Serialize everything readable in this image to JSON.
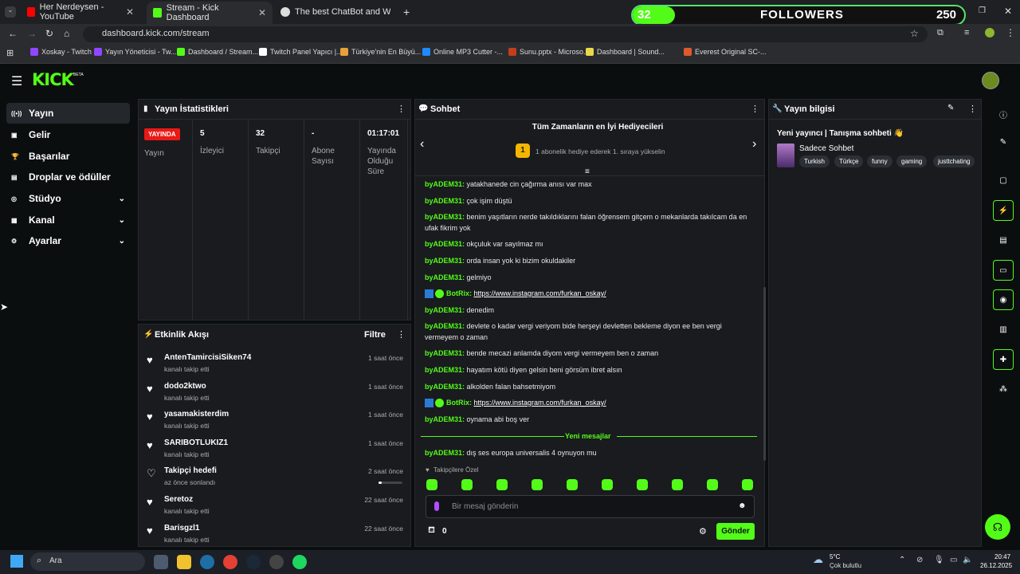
{
  "browser": {
    "tabs": [
      {
        "title": "Her Nerdeysen - YouTube"
      },
      {
        "title": "Stream - Kick Dashboard"
      },
      {
        "title": "The best ChatBot and Widgets"
      }
    ],
    "url": "dashboard.kick.com/stream",
    "bookmarks": [
      "Xoskay - Twitch",
      "Yayın Yöneticisi - Tw...",
      "Dashboard / Stream...",
      "Twitch Panel Yapıcı |...",
      "Türkiye'nin En Büyü...",
      "Online MP3 Cutter -...",
      "Sunu.pptx - Microso...",
      "Dashboard | Sound...",
      "Everest Original SC-..."
    ]
  },
  "overlay": {
    "current": "32",
    "label": "FOLLOWERS",
    "goal": "250",
    "progress": 0.128
  },
  "kick": {
    "logo": "KICK",
    "beta": "BETA"
  },
  "nav": [
    {
      "label": "Yayın",
      "icon": "broadcast-icon"
    },
    {
      "label": "Gelir",
      "icon": "money-icon"
    },
    {
      "label": "Başarılar",
      "icon": "trophy-icon"
    },
    {
      "label": "Droplar ve ödüller",
      "icon": "gift-icon"
    },
    {
      "label": "Stüdyo",
      "icon": "camera-icon"
    },
    {
      "label": "Kanal",
      "icon": "channel-icon"
    },
    {
      "label": "Ayarlar",
      "icon": "gear-icon"
    }
  ],
  "stats": {
    "title": "Yayın İstatistikleri",
    "live_badge": "YAYINDA",
    "live_label": "Yayın",
    "items": [
      {
        "value": "5",
        "label": "İzleyici"
      },
      {
        "value": "32",
        "label": "Takipçi"
      },
      {
        "value": "-",
        "label": "Abone Sayısı"
      },
      {
        "value": "01:17:01",
        "label": "Yayında Olduğu Süre"
      }
    ]
  },
  "events": {
    "title": "Etkinlik Akışı",
    "filter": "Filtre",
    "items": [
      {
        "name": "AntenTamircisiSiken74",
        "sub": "kanalı takip etti",
        "time": "1 saat önce"
      },
      {
        "name": "dodo2ktwo",
        "sub": "kanalı takip etti",
        "time": "1 saat önce"
      },
      {
        "name": "yasamakisterdim",
        "sub": "kanalı takip etti",
        "time": "1 saat önce"
      },
      {
        "name": "SARIBOTLUKIZ1",
        "sub": "kanalı takip etti",
        "time": "1 saat önce"
      },
      {
        "name": "Takipçi hedefi",
        "sub": "az önce sonlandı",
        "time": "2 saat önce"
      },
      {
        "name": "Seretoz",
        "sub": "kanalı takip etti",
        "time": "22 saat önce"
      },
      {
        "name": "Barisgzl1",
        "sub": "kanalı takip etti",
        "time": "22 saat önce"
      }
    ]
  },
  "chat": {
    "title": "Sohbet",
    "gifters_title": "Tüm Zamanların en İyi Hediyecileri",
    "gifters_rank": "1",
    "gifters_text": "1 abonelik hediye ederek 1. sıraya yükselin",
    "messages": [
      {
        "user": "byADEM31:",
        "text": "yatakhanede cin çağırma anısı var max"
      },
      {
        "user": "byADEM31:",
        "text": "çok işim düştü"
      },
      {
        "user": "byADEM31:",
        "text": "benim yaşıtların nerde takıldıklarını falan öğrensem gitçem o mekanlarda takılcam da en ufak fikrim yok"
      },
      {
        "user": "byADEM31:",
        "text": "okçuluk var sayılmaz mı"
      },
      {
        "user": "byADEM31:",
        "text": "orda insan yok ki bizim okuldakiler"
      },
      {
        "user": "byADEM31:",
        "text": "gelmiyo"
      },
      {
        "user": "BotRix:",
        "text": "https://www.instagram.com/furkan_oskay/",
        "bot": true
      },
      {
        "user": "byADEM31:",
        "text": "denedim"
      },
      {
        "user": "byADEM31:",
        "text": "devlete o kadar vergi veriyom bide herşeyi devletten bekleme diyon ee ben vergi vermeyem o zaman"
      },
      {
        "user": "byADEM31:",
        "text": "bende mecazi anlamda diyom vergi vermeyem ben o zaman"
      },
      {
        "user": "byADEM31:",
        "text": "hayatım kötü diyen gelsin beni görsüm ibret alsın"
      },
      {
        "user": "byADEM31:",
        "text": "alkolden falan bahsetmiyom"
      },
      {
        "user": "BotRix:",
        "text": "https://www.instagram.com/furkan_oskay/",
        "bot": true
      },
      {
        "user": "byADEM31:",
        "text": "oynama abi boş ver"
      }
    ],
    "new_messages": "Yeni mesajlar",
    "last_message": {
      "user": "byADEM31:",
      "text": "dış ses europa universalis 4 oynuyon mu"
    },
    "emote_section": "Takipçilere Özel",
    "input_placeholder": "Bir mesaj gönderin",
    "points": "0",
    "send": "Gönder"
  },
  "info": {
    "title": "Yayın bilgisi",
    "stream_title": "Yeni yayıncı | Tanışma sohbeti 👋",
    "category": "Sadece Sohbet",
    "tags": [
      "Turkish",
      "Türkçe",
      "funny",
      "gaming",
      "justtchating"
    ]
  },
  "taskbar": {
    "search": "Ara",
    "temp": "5°C",
    "weather": "Çok bulutlu",
    "time": "20:47",
    "date": "26.12.2025"
  },
  "colors": {
    "brand": "#53fc18",
    "live": "#e91916"
  }
}
